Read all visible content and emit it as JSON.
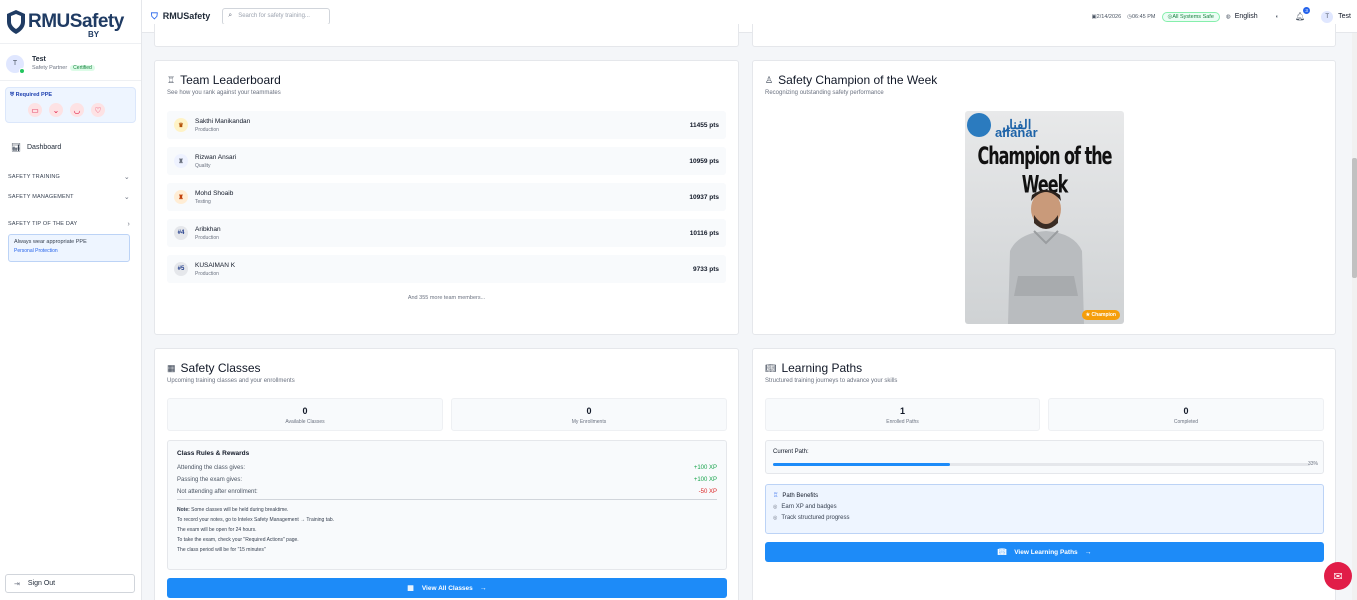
{
  "brand": {
    "name": "RMUSafety",
    "by": "BY"
  },
  "user": {
    "name": "Test",
    "role": "Safety Partner",
    "badge": "Certified",
    "initial": "T"
  },
  "ppe": {
    "title": "Required PPE"
  },
  "nav": {
    "dashboard": "Dashboard",
    "sections": [
      "SAFETY TRAINING",
      "SAFETY MANAGEMENT",
      "SAFETY TIP OF THE DAY"
    ],
    "tip": {
      "text": "Always wear appropriate PPE",
      "category": "Personal Protection"
    },
    "signout": "Sign Out"
  },
  "topbar": {
    "app_name": "RMUSafety",
    "search_placeholder": "Search for safety training...",
    "date": "2/14/2026",
    "time": "06:45 PM",
    "status": "All Systems Safe",
    "language": "English",
    "notifications": "3",
    "user_initial": "T",
    "user_name": "Test"
  },
  "leaderboard": {
    "title": "Team Leaderboard",
    "subtitle": "See how you rank against your teammates",
    "rows": [
      {
        "rank": "",
        "name": "Sakthi Manikandan",
        "dept": "Production",
        "points": "11455 pts"
      },
      {
        "rank": "",
        "name": "Rizwan Ansari",
        "dept": "Quality",
        "points": "10959 pts"
      },
      {
        "rank": "",
        "name": "Mohd Shoaib",
        "dept": "Testing",
        "points": "10937 pts"
      },
      {
        "rank": "#4",
        "name": "Aribkhan",
        "dept": "Production",
        "points": "10116 pts"
      },
      {
        "rank": "#5",
        "name": "KUSAIMAN K",
        "dept": "Production",
        "points": "9733 pts"
      }
    ],
    "more": "And 355 more team members..."
  },
  "champion": {
    "title": "Safety Champion of the Week",
    "subtitle": "Recognizing outstanding safety performance",
    "image_banner": "Champion of the Week",
    "logo_ar": "الفنار",
    "logo_en": "alfanar",
    "badge": "Champion"
  },
  "classes": {
    "title": "Safety Classes",
    "subtitle": "Upcoming training classes and your enrollments",
    "stats": [
      {
        "value": "0",
        "label": "Available Classes"
      },
      {
        "value": "0",
        "label": "My Enrollments"
      }
    ],
    "rules_title": "Class Rules & Rewards",
    "rules": [
      {
        "label": "Attending the class gives:",
        "value": "+100 XP"
      },
      {
        "label": "Passing the exam gives:",
        "value": "+100 XP"
      },
      {
        "label": "Not attending after enrollment:",
        "value": "-50 XP"
      }
    ],
    "note_label": "Note:",
    "notes": [
      "Some classes will be held during breaktime.",
      "To record your notes, go to Intelex Safety Management → Training tab.",
      "The exam will be open for 24 hours.",
      "To take the exam, check your \"Required Actions\" page.",
      "The class period will be for \"15 minutes\""
    ],
    "cta": "View All Classes"
  },
  "paths": {
    "title": "Learning Paths",
    "subtitle": "Structured training journeys to advance your skills",
    "stats": [
      {
        "value": "1",
        "label": "Enrolled Paths"
      },
      {
        "value": "0",
        "label": "Completed"
      }
    ],
    "current_label": "Current Path:",
    "progress": 0.33,
    "progress_text": "33%",
    "benefits_title": "Path Benefits",
    "benefits": [
      "Earn XP and badges",
      "Track structured progress"
    ],
    "cta": "View Learning Paths"
  },
  "colors": {
    "accent": "#1d8bf8",
    "brand": "#1f3b63",
    "success": "#16a34a",
    "danger": "#dc2626"
  }
}
